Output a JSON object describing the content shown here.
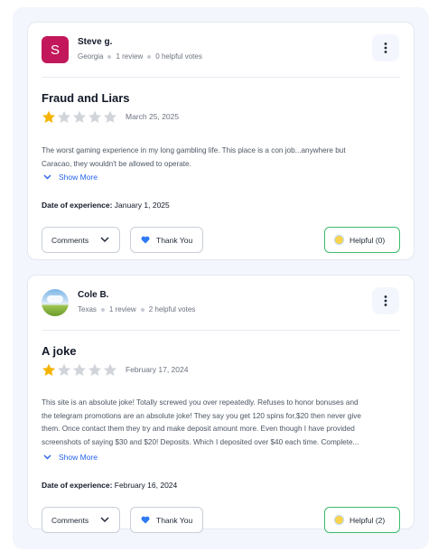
{
  "reviews": [
    {
      "avatar_letter": "S",
      "avatar_color": "#c2185b",
      "name": "Steve g.",
      "location": "Georgia",
      "review_count": "1 review",
      "helpful_votes": "0 helpful votes",
      "title": "Fraud and Liars",
      "rating": 1,
      "rating_max": 5,
      "date": "March 25, 2025",
      "body_lines": [
        "The worst gaming experience in my long gambling life. This place is a con job...anywhere but",
        "Caracao, they wouldn't be allowed to operate."
      ],
      "show_more": "Show More",
      "experience_label": "Date of experience:",
      "experience_date": "January 1, 2025",
      "comments_label": "Comments",
      "thank_label": "Thank You",
      "helpful_label": "Helpful (0)"
    },
    {
      "avatar_letter": "",
      "name": "Cole B.",
      "location": "Texas",
      "review_count": "1 review",
      "helpful_votes": "2 helpful votes",
      "title": "A joke",
      "rating": 1,
      "rating_max": 5,
      "date": "February 17, 2024",
      "body_lines": [
        "This site is an absolute joke! Totally screwed you over repeatedly. Refuses to honor bonuses and",
        "the telegram promotions are an absolute joke! They say you get 120 spins for,$20 then never give",
        "them. Once contact them they try and make deposit amount more. Even though I have provided",
        "screenshots of saying $30 and $20! Deposits. Which I deposited over $40 each time. Complete..."
      ],
      "show_more": "Show More",
      "experience_label": "Date of experience:",
      "experience_date": "February 16, 2024",
      "comments_label": "Comments",
      "thank_label": "Thank You",
      "helpful_label": "Helpful (2)"
    }
  ],
  "colors": {
    "accent_link": "#2563eb",
    "helpful_border": "#3dbb6b",
    "star_filled": "#f5b301",
    "star_empty": "#d1d5db"
  }
}
